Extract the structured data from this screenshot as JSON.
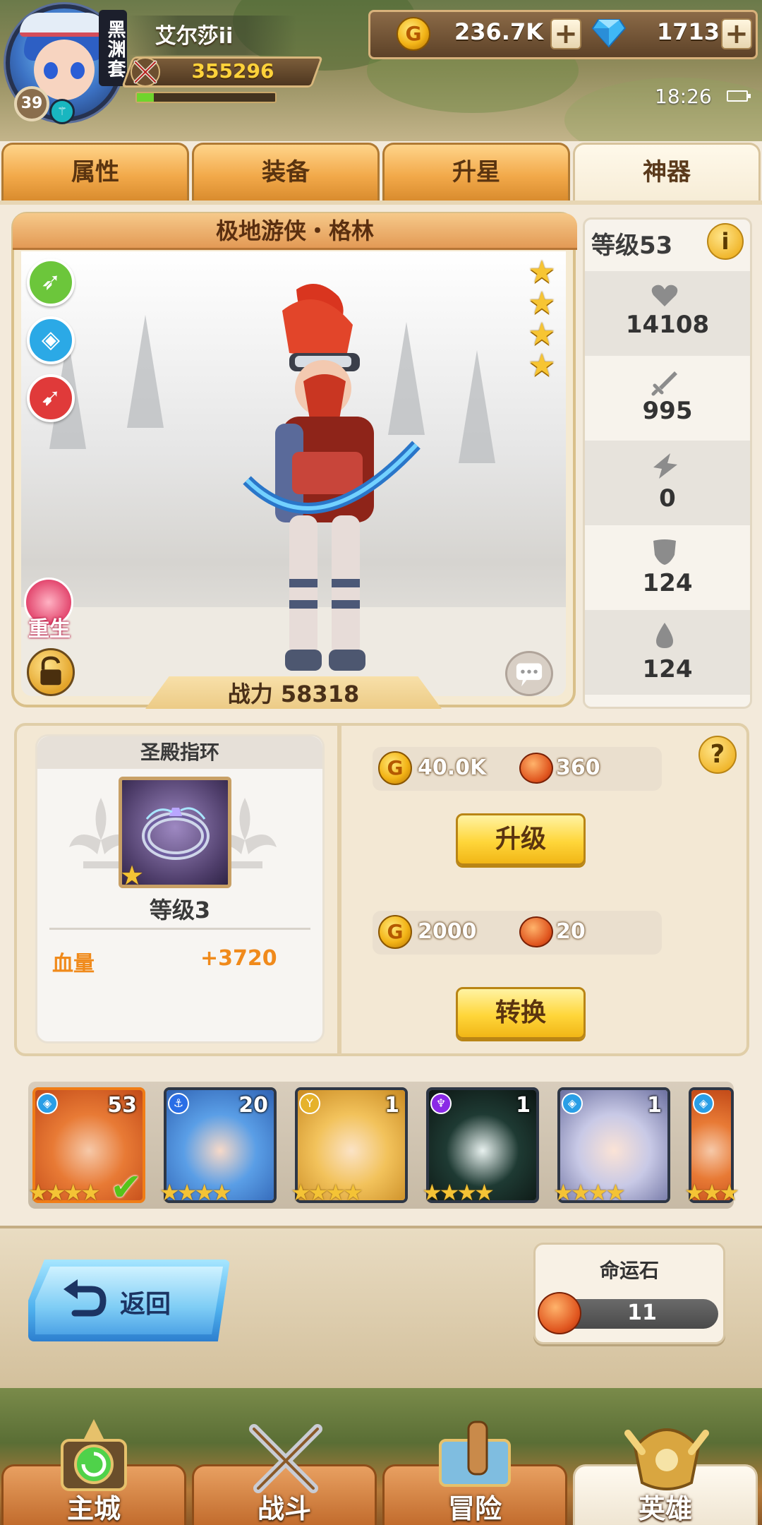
{
  "player": {
    "name": "艾尔莎ii",
    "guild_tag": "黑渊套",
    "level": "39",
    "power": "355296",
    "xp_fraction": 0.12
  },
  "currency": {
    "gold": "236.7K",
    "gems": "1713",
    "add_symbol": "+"
  },
  "status": {
    "time": "18:26"
  },
  "tabs": [
    {
      "label": "属性"
    },
    {
      "label": "装备"
    },
    {
      "label": "升星"
    },
    {
      "label": "神器",
      "active": true
    }
  ],
  "hero": {
    "name": "极地游侠・格林",
    "stars": 4,
    "power_label": "战力 58318",
    "rebirth_label": "重生",
    "skills": [
      "bow-skill-icon",
      "shield-skill-icon",
      "rocket-skill-icon"
    ]
  },
  "stats": {
    "level_label": "等级53",
    "info_symbol": "i",
    "items": [
      {
        "icon": "heart-icon",
        "value": "14108"
      },
      {
        "icon": "sword-icon",
        "value": "995"
      },
      {
        "icon": "crit-icon",
        "value": "0"
      },
      {
        "icon": "armor-icon",
        "value": "124"
      },
      {
        "icon": "resist-icon",
        "value": "124"
      }
    ]
  },
  "artifact": {
    "name": "圣殿指环",
    "level_label": "等级3",
    "bonus_label": "血量",
    "bonus_value": "+3720",
    "upgrade_cost_gold": "40.0K",
    "upgrade_cost_ore": "360",
    "upgrade_label": "升级",
    "convert_cost_gold": "2000",
    "convert_cost_ore": "20",
    "convert_label": "转换",
    "help_symbol": "?"
  },
  "roster": [
    {
      "level": "53",
      "element": "blue",
      "stars": "★★★★",
      "selected": true
    },
    {
      "level": "20",
      "element": "blue",
      "stars": "★★★★"
    },
    {
      "level": "1",
      "element": "yellow",
      "stars": "★★★★"
    },
    {
      "level": "1",
      "element": "purple",
      "stars": "★★★★"
    },
    {
      "level": "1",
      "element": "blue",
      "stars": "★★★★"
    },
    {
      "level": "",
      "element": "blue",
      "stars": "★★★"
    }
  ],
  "bottom": {
    "back_label": "返回",
    "fate_title": "命运石",
    "fate_count": "11"
  },
  "nav": [
    {
      "label": "主城"
    },
    {
      "label": "战斗"
    },
    {
      "label": "冒险"
    },
    {
      "label": "英雄",
      "active": true
    }
  ],
  "colors": {
    "tab_orange": "#f2a94a",
    "accent_yellow": "#ffd63a",
    "bonus_orange": "#f08a1b",
    "selected_border": "#f07d16"
  }
}
